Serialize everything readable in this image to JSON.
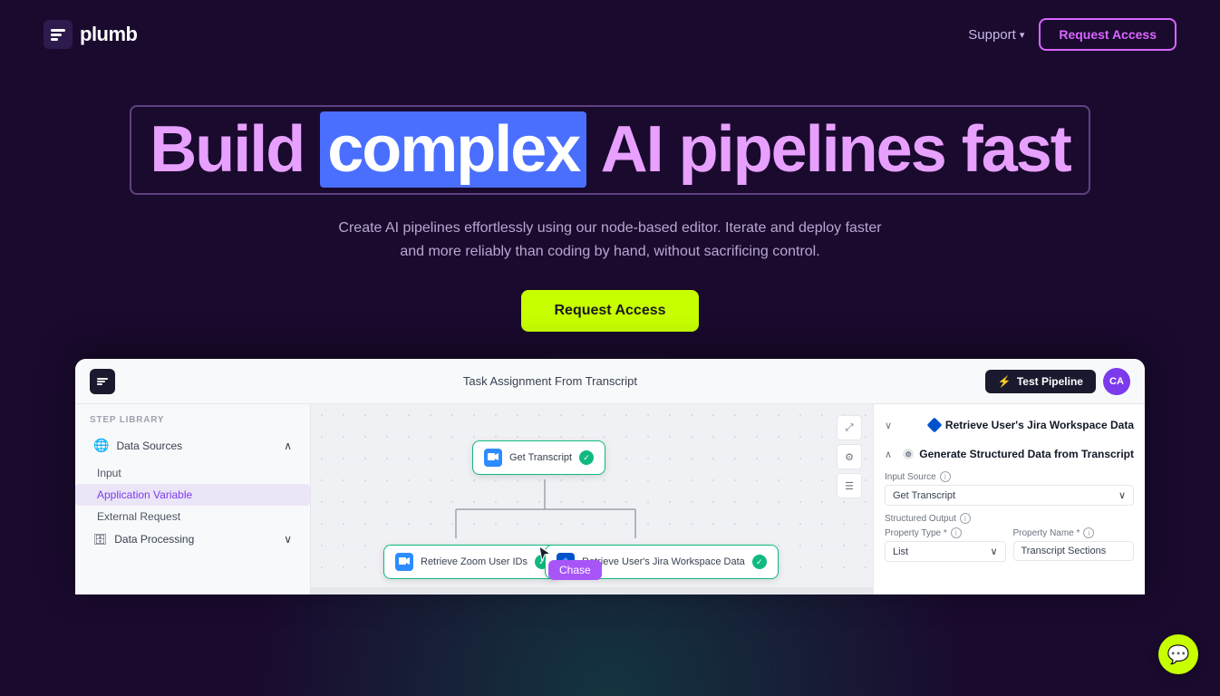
{
  "nav": {
    "logo": "plumb",
    "support_label": "Support",
    "chevron": "▾",
    "request_access_label": "Request Access"
  },
  "hero": {
    "title_part1": "Build ",
    "title_highlight": "complex",
    "title_part2": " AI pipelines fast",
    "subtitle": "Create AI pipelines effortlessly using our node-based editor. Iterate and deploy faster and more reliably than coding by hand, without sacrificing control.",
    "cta_label": "Request Access"
  },
  "app": {
    "title": "Task Assignment From Transcript",
    "test_pipeline_label": "Test Pipeline",
    "avatar_initials": "CA",
    "sidebar": {
      "step_library_label": "STEP LIBRARY",
      "data_sources_label": "Data Sources",
      "input_label": "Input",
      "app_variable_label": "Application Variable",
      "external_request_label": "External Request",
      "data_processing_label": "Data Processing"
    },
    "nodes": {
      "get_transcript": "Get Transcript",
      "retrieve_zoom": "Retrieve Zoom User IDs",
      "retrieve_jira": "Retrieve User's Jira Workspace Data"
    },
    "tooltip": "Chase",
    "right_panel": {
      "section1_label": "Retrieve User's Jira Workspace Data",
      "section2_label": "Generate Structured Data from Transcript",
      "input_source_label": "Input Source",
      "input_source_info": "ⓘ",
      "input_source_value": "Get Transcript",
      "structured_output_label": "Structured Output",
      "structured_output_info": "ⓘ",
      "property_type_label": "Property Type *",
      "property_type_info": "ⓘ",
      "property_type_value": "List",
      "property_name_label": "Property Name *",
      "property_name_info": "ⓘ",
      "property_name_value": "Transcript Sections"
    }
  },
  "chat_icon": "💬"
}
